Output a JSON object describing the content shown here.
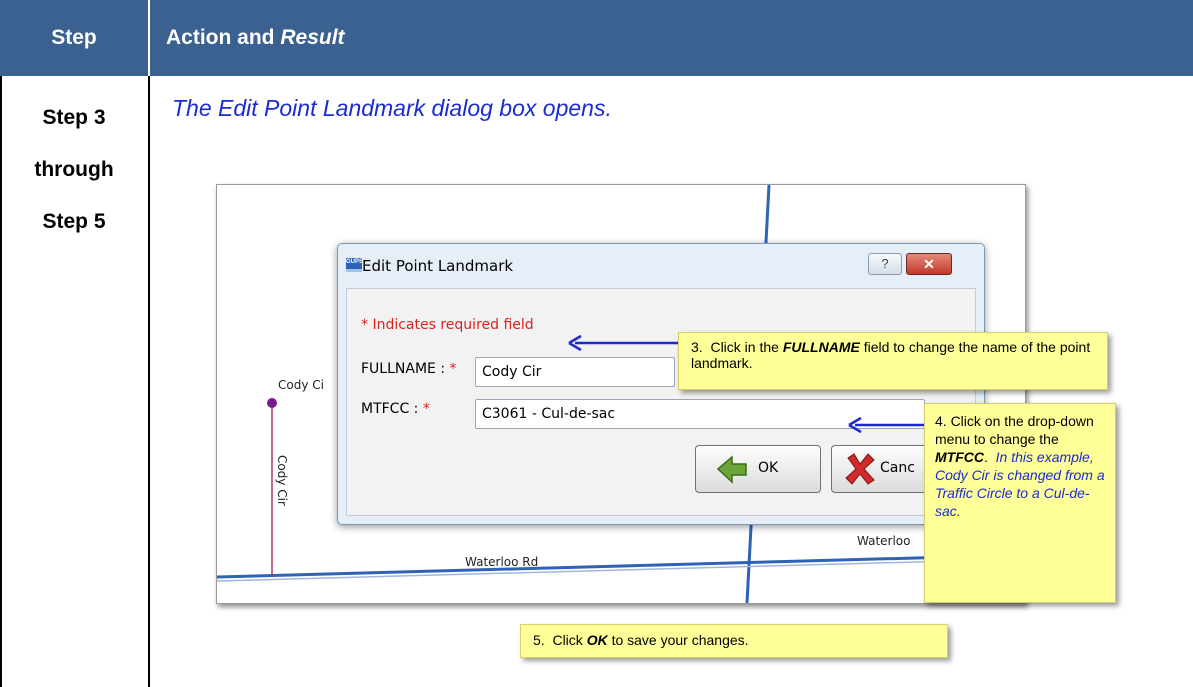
{
  "header": {
    "step": "Step",
    "action": "Action and ",
    "action_italic": "Result"
  },
  "steps": {
    "line1": "Step 3",
    "line2": "through",
    "line3": "Step 5"
  },
  "intro": "The Edit Point Landmark dialog box opens.",
  "map": {
    "label_cody_cir": "Cody Ci",
    "label_cody_cir_vertical": "Cody Cir",
    "label_waterloo": "Waterloo Rd",
    "label_waterloo_right": "Waterloo"
  },
  "dialog": {
    "logo": "GUPS",
    "title": "Edit Point Landmark",
    "help": "?",
    "close": "✕",
    "required_note": "* Indicates required field",
    "fullname_label": "FULLNAME :",
    "fullname_value": "Cody Cir",
    "mtfcc_label": "MTFCC :",
    "mtfcc_value": "C3061 - Cul-de-sac",
    "required_star": "*",
    "ok_label": "OK",
    "cancel_label": "Canc"
  },
  "callouts": {
    "c3_a": "3.  Click in the ",
    "c3_b": "FULLNAME",
    "c3_c": " field to change the name of the point landmark.",
    "c4_a": "4. Click on the drop-down menu to change the ",
    "c4_b": "MTFCC",
    "c4_c": ".  ",
    "c4_d": "In this example, Cody Cir is changed from a Traffic Circle to a Cul-de-sac.",
    "c5_a": "5.  Click ",
    "c5_b": "OK",
    "c5_c": " to save your changes."
  },
  "colors": {
    "header_bg": "#3a6190",
    "intro_text": "#1b2bd0",
    "callout_bg": "#ffff99",
    "arrow": "#1b2bd0"
  }
}
